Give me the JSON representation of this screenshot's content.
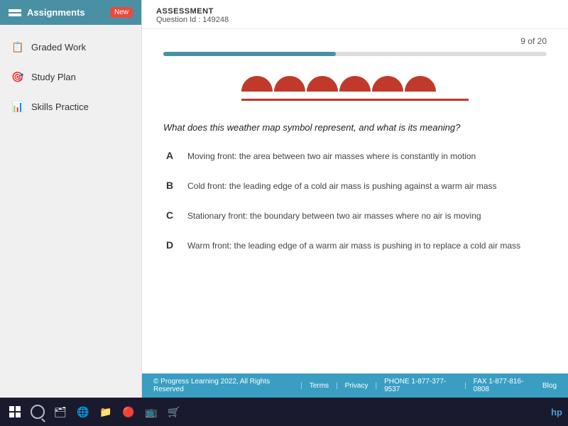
{
  "sidebar": {
    "header_title": "Assignments",
    "new_badge": "New",
    "items": [
      {
        "id": "graded-work",
        "label": "Graded Work",
        "icon": "📋"
      },
      {
        "id": "study-plan",
        "label": "Study Plan",
        "icon": "🎯"
      },
      {
        "id": "skills-practice",
        "label": "Skills Practice",
        "icon": "📊"
      }
    ]
  },
  "assessment": {
    "section_label": "ASSESSMENT",
    "question_id_label": "Question Id : 149248",
    "question_counter": "9 of 20",
    "progress_percent": 45,
    "question_text": "What does this weather map symbol represent, and what is its meaning?",
    "options": [
      {
        "letter": "A",
        "text": "Moving front: the area between two air masses where is constantly in motion"
      },
      {
        "letter": "B",
        "text": "Cold front: the leading edge of a cold air mass is pushing against a warm air mass"
      },
      {
        "letter": "C",
        "text": "Stationary front: the boundary between two air masses where no air is moving"
      },
      {
        "letter": "D",
        "text": "Warm front: the leading edge of a warm air mass is pushing in to replace a cold air mass"
      }
    ]
  },
  "footer": {
    "copyright": "© Progress Learning 2022, All Rights Reserved",
    "links": [
      "Terms",
      "Privacy",
      "PHONE 1-877-377-9537",
      "FAX 1-877-816-0808",
      "Blog"
    ]
  },
  "colors": {
    "sidebar_bg": "#4a90a4",
    "new_badge": "#e74c3c",
    "front_color": "#c0392b",
    "footer_bg": "#3a9ec2"
  }
}
